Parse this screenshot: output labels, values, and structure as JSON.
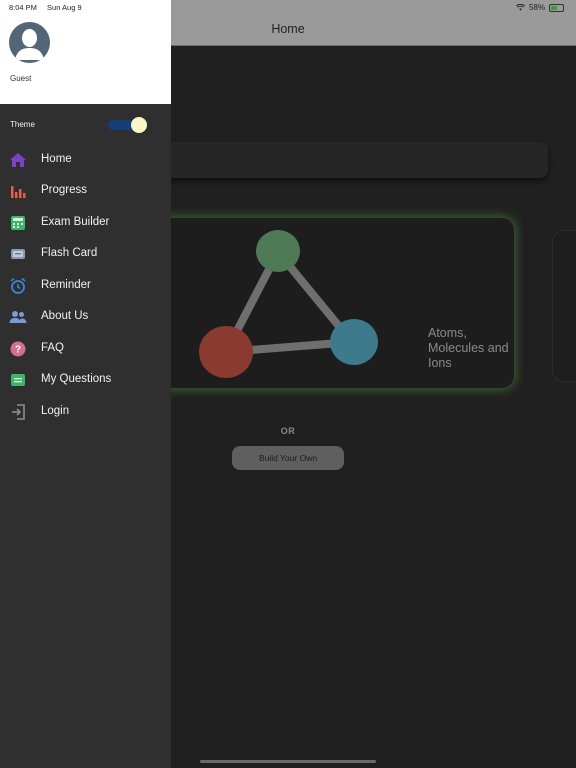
{
  "status_bar": {
    "time": "8:04 PM",
    "date": "Sun Aug 9",
    "battery": "58%"
  },
  "header": {
    "title": "Home"
  },
  "drawer": {
    "user_name": "Guest",
    "theme_label": "Theme",
    "theme_dark": true,
    "menu": [
      {
        "label": "Home",
        "icon": "house-icon",
        "color": "#7b43cc"
      },
      {
        "label": "Progress",
        "icon": "bar-chart-icon",
        "color": "#e0604a"
      },
      {
        "label": "Exam Builder",
        "icon": "calculator-icon",
        "color": "#3fb56a"
      },
      {
        "label": "Flash Card",
        "icon": "flash-card-icon",
        "color": "#8a98b0"
      },
      {
        "label": "Reminder",
        "icon": "alarm-clock-icon",
        "color": "#3a86d9"
      },
      {
        "label": "About Us",
        "icon": "people-icon",
        "color": "#7d9ad6"
      },
      {
        "label": "FAQ",
        "icon": "question-icon",
        "color": "#d56e93"
      },
      {
        "label": "My Questions",
        "icon": "message-icon",
        "color": "#3fb56a"
      },
      {
        "label": "Login",
        "icon": "login-icon",
        "color": "#8d8d8d"
      }
    ]
  },
  "main": {
    "topic_card": {
      "label": "Atoms, Molecules and Ions"
    },
    "or_label": "OR",
    "build_button": "Build Your Own"
  }
}
